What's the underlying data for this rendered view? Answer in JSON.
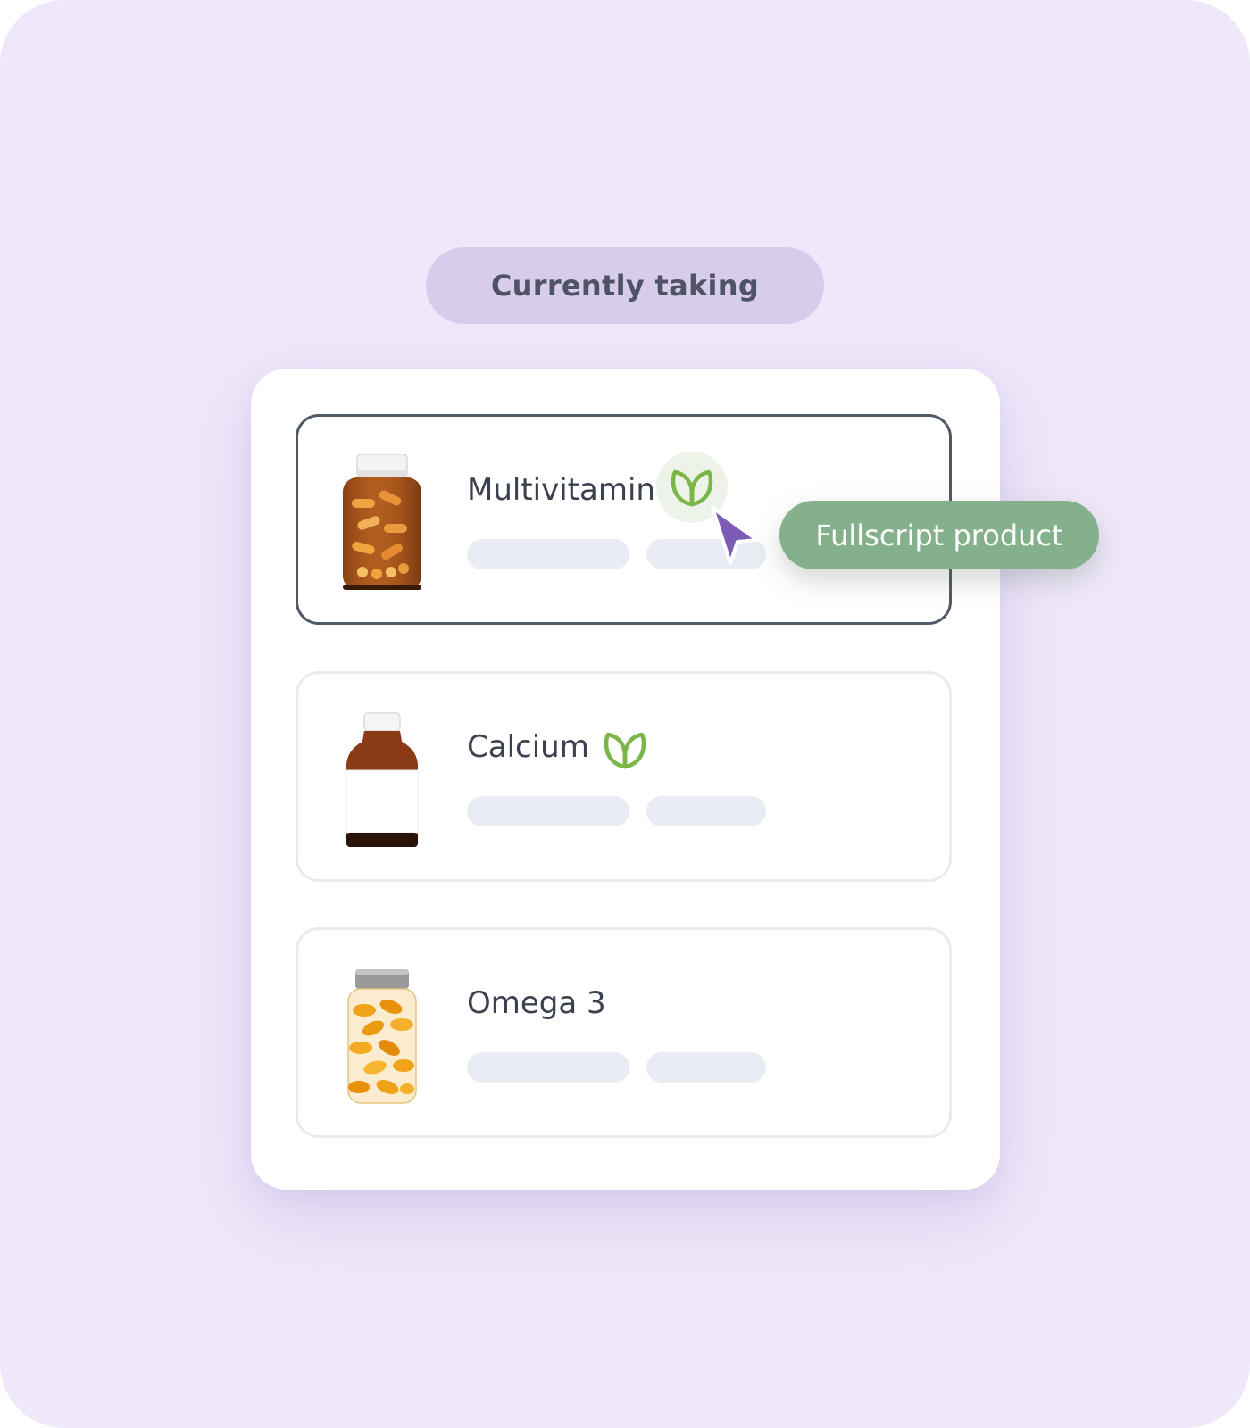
{
  "heading": {
    "label": "Currently taking"
  },
  "items": [
    {
      "name": "Multivitamin",
      "badge_icon": "leaf-icon",
      "selected": true
    },
    {
      "name": "Calcium",
      "badge_icon": "leaf-icon",
      "selected": false
    },
    {
      "name": "Omega 3",
      "selected": false
    }
  ],
  "tooltip": {
    "label": "Fullscript product"
  },
  "colors": {
    "background": "#efe8fa",
    "heading_pill": "#d8ccec",
    "tooltip": "#84b08c",
    "leaf": "#7ab648",
    "cursor": "#7b5bb5",
    "selected_border": "#505a66"
  }
}
